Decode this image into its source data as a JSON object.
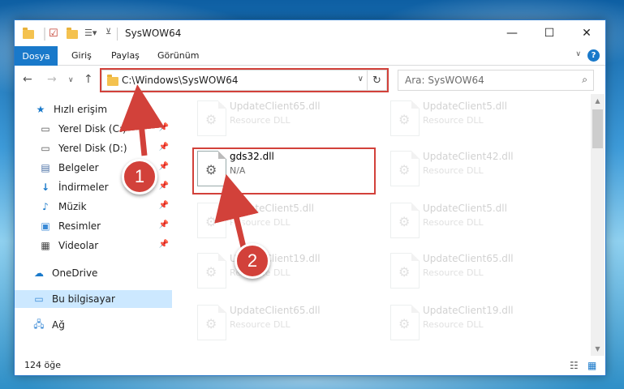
{
  "window": {
    "title": "SysWOW64",
    "minimize": "—",
    "maximize": "☐",
    "close": "✕"
  },
  "ribbon": {
    "file_tab": "Dosya",
    "tabs": [
      "Giriş",
      "Paylaş",
      "Görünüm"
    ],
    "help": "?"
  },
  "navbar": {
    "address": "C:\\Windows\\SysWOW64",
    "search_placeholder": "Ara: SysWOW64"
  },
  "sidebar": {
    "quick_access": "Hızlı erişim",
    "items": [
      {
        "label": "Yerel Disk (C:)",
        "icon": "drive-icon"
      },
      {
        "label": "Yerel Disk (D:)",
        "icon": "drive-icon"
      },
      {
        "label": "Belgeler",
        "icon": "documents-icon"
      },
      {
        "label": "İndirmeler",
        "icon": "downloads-icon"
      },
      {
        "label": "Müzik",
        "icon": "music-icon"
      },
      {
        "label": "Resimler",
        "icon": "pictures-icon"
      },
      {
        "label": "Videolar",
        "icon": "videos-icon"
      }
    ],
    "onedrive": "OneDrive",
    "this_pc": "Bu bilgisayar",
    "network": "Ağ"
  },
  "files": [
    {
      "name": "UpdateClient65.dll",
      "type": "Resource DLL"
    },
    {
      "name": "UpdateClient5.dll",
      "type": "Resource DLL"
    },
    {
      "name": "gds32.dll",
      "type": "N/A"
    },
    {
      "name": "UpdateClient42.dll",
      "type": "Resource DLL"
    },
    {
      "name": "UpdateClient5.dll",
      "type": "Resource DLL"
    },
    {
      "name": "UpdateClient5.dll",
      "type": "Resource DLL"
    },
    {
      "name": "UpdateClient19.dll",
      "type": "Resource DLL"
    },
    {
      "name": "UpdateClient65.dll",
      "type": "Resource DLL"
    },
    {
      "name": "UpdateClient65.dll",
      "type": "Resource DLL"
    },
    {
      "name": "UpdateClient19.dll",
      "type": "Resource DLL"
    }
  ],
  "status": {
    "item_count": "124 öğe"
  },
  "callouts": {
    "step1": "1",
    "step2": "2"
  },
  "colors": {
    "accent": "#1979ca",
    "highlight": "#d2413a",
    "selected": "#cce8ff"
  }
}
